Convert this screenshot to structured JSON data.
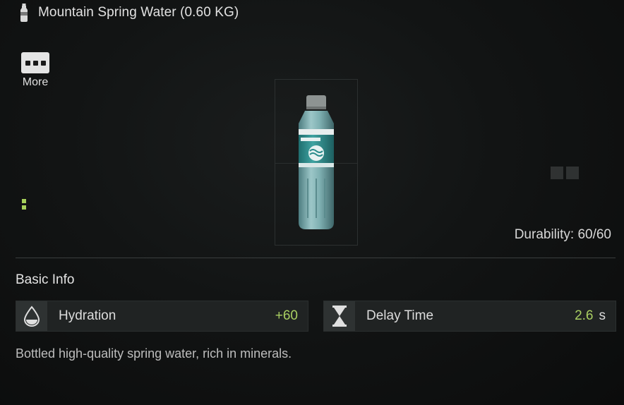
{
  "item": {
    "title": "Mountain Spring Water (0.60 KG)",
    "icon": "water-bottle-icon"
  },
  "actions": {
    "more_label": "More",
    "more_icon": "ellipsis-icon"
  },
  "status": {
    "durability": "Durability: 60/60"
  },
  "basic_info": {
    "section_title": "Basic Info",
    "stats": [
      {
        "icon": "water-drop-icon",
        "label": "Hydration",
        "value": "+60",
        "unit": ""
      },
      {
        "icon": "hourglass-icon",
        "label": "Delay Time",
        "value": "2.6",
        "unit": "s"
      }
    ],
    "description": "Bottled high-quality spring water, rich in minerals."
  },
  "colors": {
    "accent_green": "#a9cf62",
    "background": "#0d0f0f",
    "stat_background": "#202323",
    "text": "#dcdcdc"
  }
}
